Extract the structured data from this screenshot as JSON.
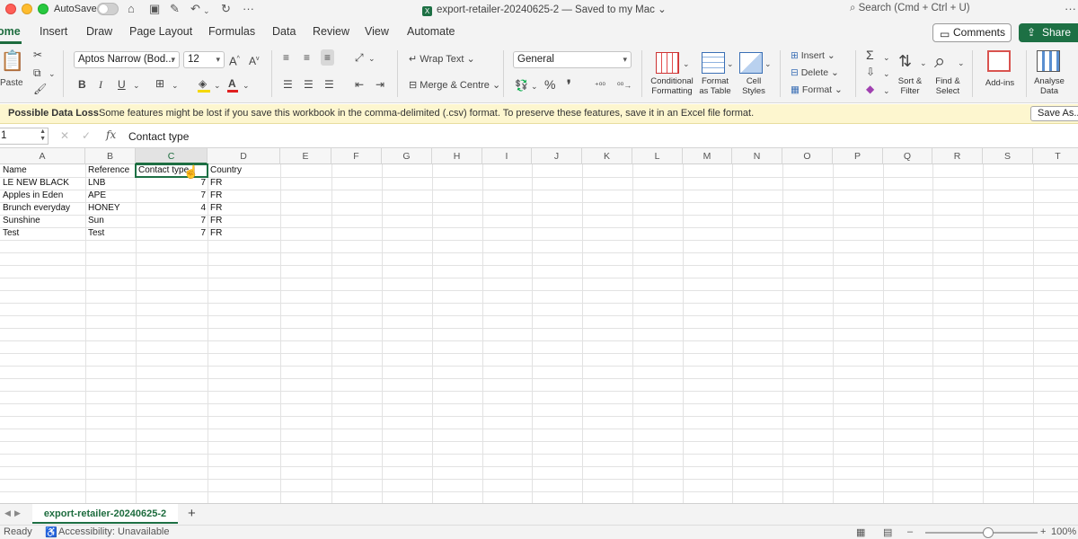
{
  "titlebar": {
    "autosave_label": "AutoSave",
    "autosave_on": false,
    "document_title": "export-retailer-20240625-2 — Saved to my Mac ⌄",
    "search_placeholder": "Search (Cmd + Ctrl + U)"
  },
  "ribbon_tabs": [
    "ome",
    "Insert",
    "Draw",
    "Page Layout",
    "Formulas",
    "Data",
    "Review",
    "View",
    "Automate"
  ],
  "active_tab": "Home",
  "buttons": {
    "comments": "Comments",
    "share": "Share"
  },
  "ribbon": {
    "paste_label": "Paste",
    "font_name": "Aptos Narrow (Bod...",
    "font_size": "12",
    "wrap_text": "Wrap Text",
    "merge_centre": "Merge & Centre",
    "number_format": "General",
    "conditional_formatting_1": "Conditional",
    "conditional_formatting_2": "Formatting",
    "format_as_table_1": "Format",
    "format_as_table_2": "as Table",
    "cell_styles_1": "Cell",
    "cell_styles_2": "Styles",
    "insert": "Insert",
    "delete": "Delete",
    "format": "Format",
    "sort_filter_1": "Sort &",
    "sort_filter_2": "Filter",
    "find_select_1": "Find &",
    "find_select_2": "Select",
    "add_ins": "Add-ins",
    "analyse_data_1": "Analyse",
    "analyse_data_2": "Data"
  },
  "notification": {
    "title": "Possible Data Loss",
    "message": "Some features might be lost if you save this workbook in the comma-delimited (.csv) format. To preserve these features, save it in an Excel file format.",
    "button": "Save As..."
  },
  "formula_bar": {
    "name_box": "1",
    "content": "Contact type"
  },
  "columns": [
    "A",
    "B",
    "C",
    "D",
    "E",
    "F",
    "G",
    "H",
    "I",
    "J",
    "K",
    "L",
    "M",
    "N",
    "O",
    "P",
    "Q",
    "R",
    "S",
    "T"
  ],
  "selected_column": "C",
  "rows": [
    [
      "Name",
      "Reference",
      "Contact type",
      "Country"
    ],
    [
      " LE NEW BLACK",
      "LNB",
      "7",
      "FR"
    ],
    [
      "Apples in Eden",
      "APE",
      "7",
      "FR"
    ],
    [
      "Brunch everyday",
      "HONEY",
      "4",
      "FR"
    ],
    [
      "Sunshine",
      "Sun",
      "7",
      "FR"
    ],
    [
      "Test",
      "Test",
      "7",
      "FR"
    ]
  ],
  "sheet_tab": "export-retailer-20240625-2",
  "status": {
    "ready": "Ready",
    "accessibility": "Accessibility: Unavailable",
    "zoom": "100%"
  },
  "colors": {
    "accent": "#1d7044",
    "notification_bg": "#fdf6cf"
  }
}
